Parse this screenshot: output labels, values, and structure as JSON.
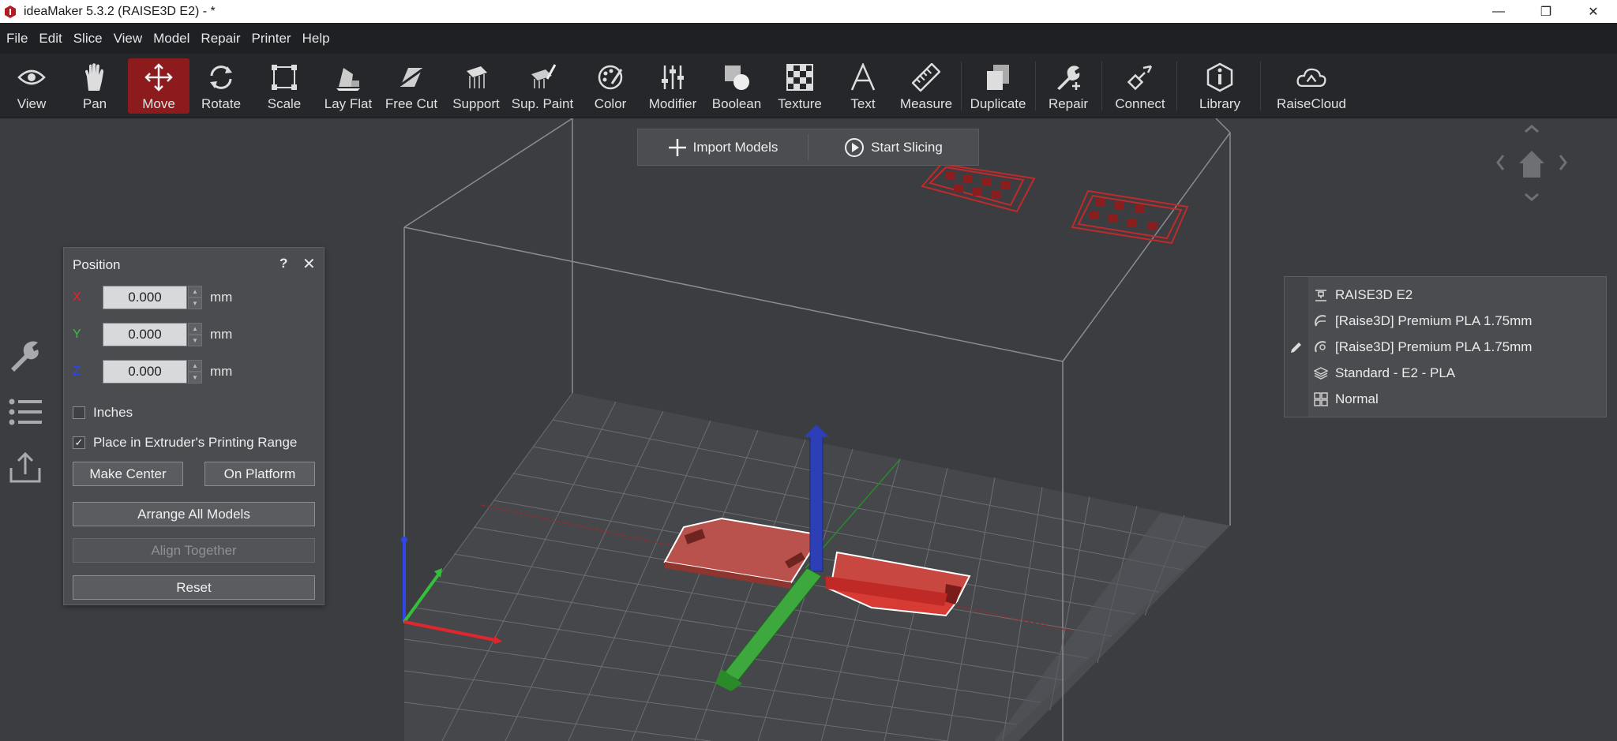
{
  "window": {
    "title": "ideaMaker 5.3.2 (RAISE3D E2) - *",
    "minimize": "—",
    "maximize": "❐",
    "close": "✕"
  },
  "menu": [
    "File",
    "Edit",
    "Slice",
    "View",
    "Model",
    "Repair",
    "Printer",
    "Help"
  ],
  "toolbar": {
    "tools": [
      {
        "label": "View",
        "icon": "eye-icon"
      },
      {
        "label": "Pan",
        "icon": "hand-icon"
      },
      {
        "label": "Move",
        "icon": "move-arrows-icon",
        "active": true
      },
      {
        "label": "Rotate",
        "icon": "rotate-icon"
      },
      {
        "label": "Scale",
        "icon": "scale-icon"
      },
      {
        "label": "Lay Flat",
        "icon": "lay-flat-icon"
      },
      {
        "label": "Free Cut",
        "icon": "free-cut-icon"
      },
      {
        "label": "Support",
        "icon": "support-icon"
      },
      {
        "label": "Sup. Paint",
        "icon": "support-paint-icon"
      },
      {
        "label": "Color",
        "icon": "color-icon"
      },
      {
        "label": "Modifier",
        "icon": "modifier-icon"
      },
      {
        "label": "Boolean",
        "icon": "boolean-icon"
      },
      {
        "label": "Texture",
        "icon": "texture-icon"
      },
      {
        "label": "Text",
        "icon": "text-icon"
      },
      {
        "label": "Measure",
        "icon": "measure-icon"
      },
      {
        "label": "Duplicate",
        "icon": "duplicate-icon"
      },
      {
        "label": "Repair",
        "icon": "repair-icon"
      },
      {
        "label": "Connect",
        "icon": "connect-icon"
      },
      {
        "label": "Library",
        "icon": "library-icon"
      },
      {
        "label": "RaiseCloud",
        "icon": "cloud-icon"
      }
    ]
  },
  "actions": {
    "import_label": "Import Models",
    "slice_label": "Start Slicing"
  },
  "position_panel": {
    "title": "Position",
    "help": "?",
    "close": "✕",
    "x_label": "X",
    "y_label": "Y",
    "z_label": "Z",
    "x_value": "0.000",
    "y_value": "0.000",
    "z_value": "0.000",
    "unit": "mm",
    "inches_label": "Inches",
    "inches_checked": false,
    "extruder_label": "Place in Extruder's Printing Range",
    "extruder_checked": true,
    "check_mark": "✓",
    "make_center": "Make Center",
    "on_platform": "On Platform",
    "arrange_all": "Arrange All Models",
    "align_together": "Align Together",
    "reset": "Reset"
  },
  "printer_info": {
    "printer": "RAISE3D E2",
    "filament_left": "[Raise3D] Premium PLA 1.75mm",
    "filament_right": "[Raise3D] Premium PLA 1.75mm",
    "profile": "Standard - E2 - PLA",
    "mode": "Normal"
  },
  "colors": {
    "accent": "#8d1b1e",
    "model": "#c9443f",
    "axis_x": "#e0262b",
    "axis_y": "#34c13a",
    "axis_z": "#2f47e8"
  }
}
